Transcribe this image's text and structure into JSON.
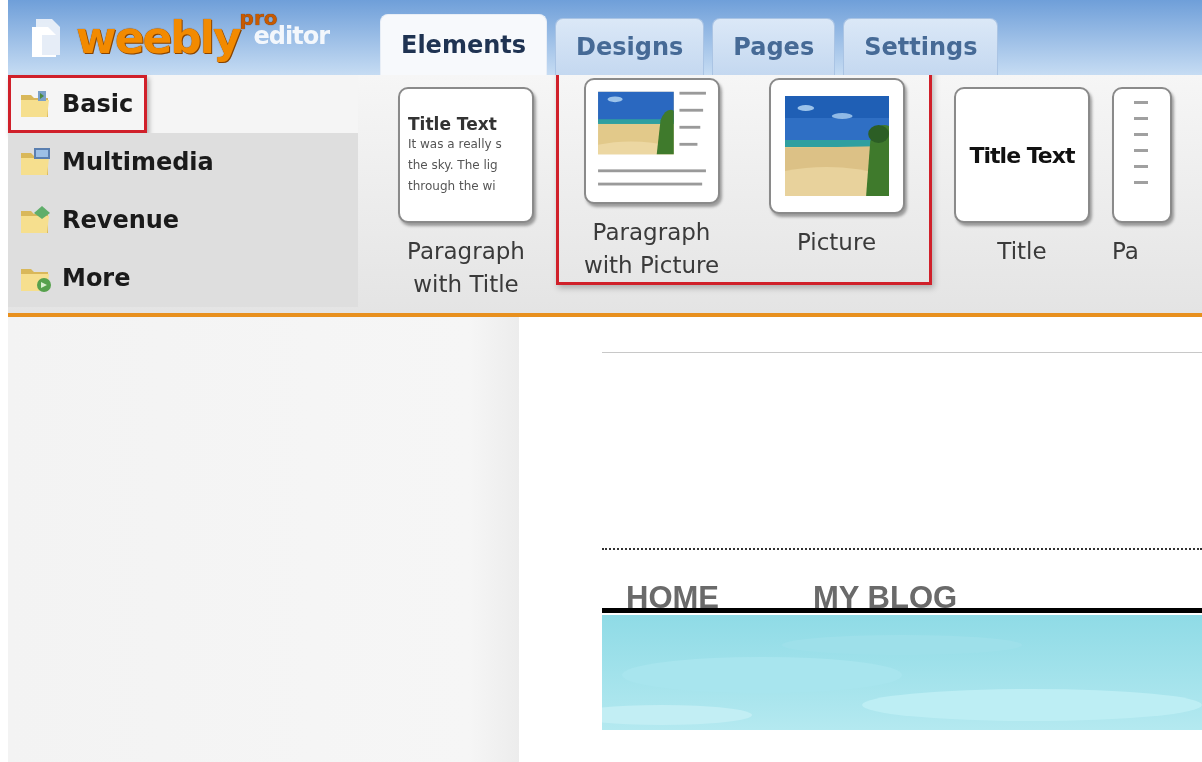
{
  "logo": {
    "brand": "weebly",
    "badge": "pro",
    "suffix": "editor"
  },
  "tabs": [
    {
      "label": "Elements",
      "selected": true
    },
    {
      "label": "Designs",
      "selected": false
    },
    {
      "label": "Pages",
      "selected": false
    },
    {
      "label": "Settings",
      "selected": false
    }
  ],
  "categories": [
    {
      "label": "Basic",
      "selected": true,
      "highlighted": true
    },
    {
      "label": "Multimedia",
      "selected": false,
      "highlighted": false
    },
    {
      "label": "Revenue",
      "selected": false,
      "highlighted": false
    },
    {
      "label": "More",
      "selected": false,
      "highlighted": false
    }
  ],
  "elements": [
    {
      "label": "Paragraph with Title",
      "kind": "title-paragraph",
      "highlighted": false,
      "preview": {
        "title": "Title Text",
        "lines": [
          "It was a really s",
          "the sky.  The lig",
          "through the wi"
        ]
      }
    },
    {
      "label": "Paragraph with Picture",
      "kind": "picture-paragraph",
      "highlighted": true
    },
    {
      "label": "Picture",
      "kind": "picture",
      "highlighted": true
    },
    {
      "label": "Title",
      "kind": "title",
      "highlighted": false,
      "preview": {
        "title": "Title Text"
      }
    },
    {
      "label": "Pa",
      "kind": "paragraph",
      "highlighted": false
    }
  ],
  "site": {
    "nav": [
      {
        "label": "HOME"
      },
      {
        "label": "MY BLOG"
      }
    ]
  }
}
